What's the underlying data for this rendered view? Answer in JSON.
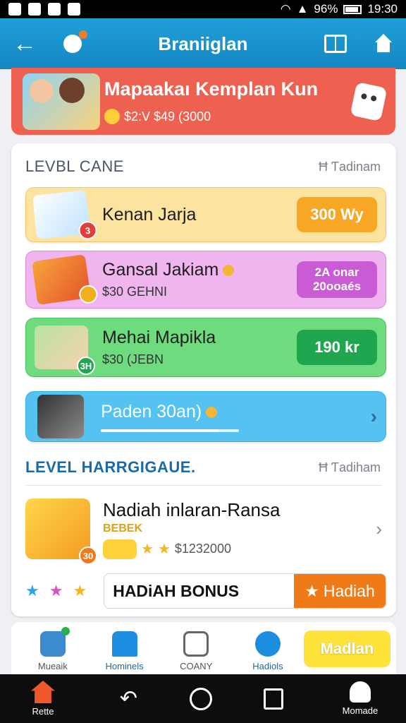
{
  "status_bar": {
    "battery": "96%",
    "time": "19:30"
  },
  "app_bar": {
    "title": "Braniiglan"
  },
  "promo": {
    "title": "Mapaakaı Kemplan Kun",
    "subtitle": "$2:V $49 (3000"
  },
  "section1": {
    "title": "LEVBL CANE",
    "link": "Ħ Ƭadinam",
    "rows": [
      {
        "title": "Kenan Jarja",
        "sub": "",
        "badge": "3",
        "button": "300 Wy"
      },
      {
        "title": "Gansal Jakiam",
        "sub": "$30 GEHNI",
        "button_line1": "2A onar",
        "button_line2": "20ooaés"
      },
      {
        "title": "Mehai Mapikla",
        "sub": "$30 (JEBN",
        "badge": "3H",
        "button": "190 kr"
      },
      {
        "title": "Paden 30an)",
        "progress": 0.85
      }
    ]
  },
  "section2": {
    "title": "LEVEL HARRGIGAUE.",
    "link": "Ħ Ƭadiham",
    "item": {
      "title": "Nadiah inlaran-Ransa",
      "tag": "BEBEK",
      "price": "$1232000",
      "badge": "30"
    },
    "bonus": {
      "label": "HADiAH BONUS",
      "button": "Hadiah"
    }
  },
  "tabs": [
    {
      "label": "Mueaik"
    },
    {
      "label": "Hominels"
    },
    {
      "label": "COANY"
    },
    {
      "label": "Hadiols"
    }
  ],
  "tab_cta": "Madlan",
  "nav": {
    "home_label": "Rette",
    "profile_label": "Momade"
  },
  "colors": {
    "accent": "#1588c3",
    "promo": "#ee6150",
    "orange": "#f07a18"
  }
}
